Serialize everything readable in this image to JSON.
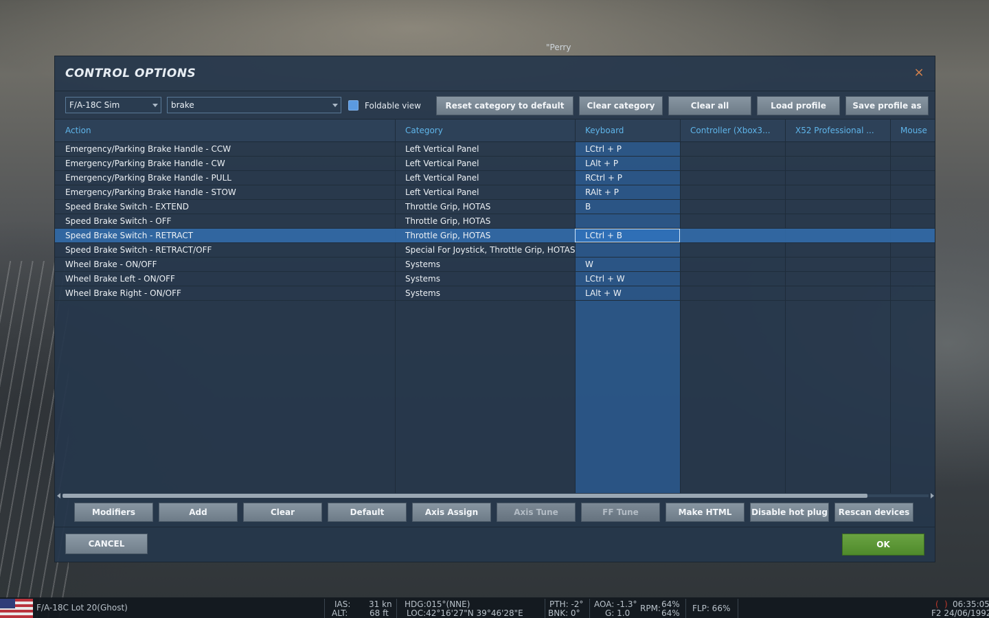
{
  "scene": {
    "callsign": "\"Perry"
  },
  "dialog": {
    "title": "CONTROL OPTIONS",
    "close_label": "×"
  },
  "toolbar": {
    "aircraft_select": "F/A-18C Sim",
    "search_value": "brake",
    "foldable_label": "Foldable view",
    "reset_category": "Reset category to default",
    "clear_category": "Clear category",
    "clear_all": "Clear all",
    "load_profile": "Load profile",
    "save_profile_as": "Save profile as"
  },
  "columns": {
    "action": "Action",
    "category": "Category",
    "keyboard": "Keyboard",
    "controller": "Controller (Xbox3...",
    "x52": "X52 Professional ...",
    "mouse": "Mouse"
  },
  "rows": [
    {
      "action": "Emergency/Parking Brake Handle - CCW",
      "category": "Left Vertical Panel",
      "keyboard": "LCtrl + P"
    },
    {
      "action": "Emergency/Parking Brake Handle - CW",
      "category": "Left Vertical Panel",
      "keyboard": "LAlt + P"
    },
    {
      "action": "Emergency/Parking Brake Handle - PULL",
      "category": "Left Vertical Panel",
      "keyboard": "RCtrl + P"
    },
    {
      "action": "Emergency/Parking Brake Handle - STOW",
      "category": "Left Vertical Panel",
      "keyboard": "RAlt + P"
    },
    {
      "action": "Speed Brake Switch - EXTEND",
      "category": "Throttle Grip, HOTAS",
      "keyboard": "B"
    },
    {
      "action": "Speed Brake Switch - OFF",
      "category": "Throttle Grip, HOTAS",
      "keyboard": ""
    },
    {
      "action": "Speed Brake Switch - RETRACT",
      "category": "Throttle Grip, HOTAS",
      "keyboard": "LCtrl + B"
    },
    {
      "action": "Speed Brake Switch - RETRACT/OFF",
      "category": "Special For Joystick, Throttle Grip, HOTAS",
      "keyboard": ""
    },
    {
      "action": "Wheel Brake - ON/OFF",
      "category": "Systems",
      "keyboard": "W"
    },
    {
      "action": "Wheel Brake Left - ON/OFF",
      "category": "Systems",
      "keyboard": "LCtrl + W"
    },
    {
      "action": "Wheel Brake Right - ON/OFF",
      "category": "Systems",
      "keyboard": "LAlt + W"
    }
  ],
  "selected_row": 6,
  "bottom_buttons": {
    "modifiers": "Modifiers",
    "add": "Add",
    "clear": "Clear",
    "default": "Default",
    "axis_assign": "Axis Assign",
    "axis_tune": "Axis Tune",
    "ff_tune": "FF Tune",
    "make_html": "Make HTML",
    "disable_hot_plug": "Disable hot plug",
    "rescan_devices": "Rescan devices"
  },
  "footer": {
    "cancel": "CANCEL",
    "ok": "OK"
  },
  "status_bar": {
    "unit": "F/A-18C Lot 20(Ghost)",
    "ias_label": "IAS:",
    "ias_value": "31 kn",
    "alt_label": "ALT:",
    "alt_value": "68 ft",
    "hdg": "HDG:015°(NNE)",
    "loc": "LOC:42°16'27\"N 39°46'28\"E",
    "pth": "PTH: -2°",
    "bnk": "BNK: 0°",
    "aoa": "AOA: -1.3°",
    "g": "G: 1.0",
    "rpm_label": "RPM:",
    "rpm_1": "64%",
    "rpm_2": "64%",
    "flp": "FLP: 66%",
    "time": "06:35:05",
    "date": "F2 24/06/1992",
    "paren_left": "(",
    "paren_right": ")"
  },
  "colors": {
    "header_text": "#5fb5ea",
    "selected_row": "#326eaf",
    "ok_button": "#5b9737",
    "close_icon": "#d8834d"
  }
}
